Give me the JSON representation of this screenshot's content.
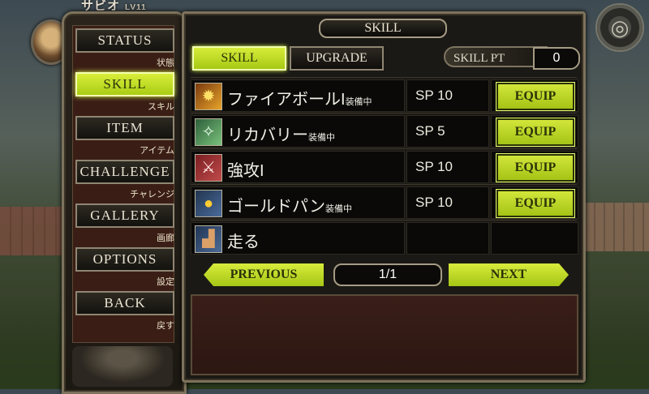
{
  "hud": {
    "player_name": "サビオ",
    "level": "LV11"
  },
  "menu": {
    "items": [
      {
        "label": "STATUS",
        "sub": "状態"
      },
      {
        "label": "SKILL",
        "sub": "スキル"
      },
      {
        "label": "ITEM",
        "sub": "アイテム"
      },
      {
        "label": "CHALLENGE",
        "sub": "チャレンジ"
      },
      {
        "label": "GALLERY",
        "sub": "画廊"
      },
      {
        "label": "OPTIONS",
        "sub": "設定"
      },
      {
        "label": "BACK",
        "sub": "戻す"
      }
    ],
    "active": "SKILL"
  },
  "panel": {
    "title": "SKILL",
    "tabs": [
      "SKILL",
      "UPGRADE"
    ],
    "skill_pt_label": "SKILL PT",
    "skill_pt_value": "0"
  },
  "skills": [
    {
      "icon": "fireball-icon",
      "name": "ファイアボールI",
      "equipped": "装備中",
      "sp": "SP 10",
      "action": "EQUIP"
    },
    {
      "icon": "recovery-icon",
      "name": "リカバリー",
      "equipped": "装備中",
      "sp": "SP 5",
      "action": "EQUIP"
    },
    {
      "icon": "power-strike-icon",
      "name": "強攻I",
      "equipped": "",
      "sp": "SP 10",
      "action": "EQUIP"
    },
    {
      "icon": "gold-pan-icon",
      "name": "ゴールドパン",
      "equipped": "装備中",
      "sp": "SP 10",
      "action": "EQUIP"
    },
    {
      "icon": "run-boot-icon",
      "name": "走る",
      "equipped": "",
      "sp": "",
      "action": ""
    }
  ],
  "pager": {
    "previous": "PREVIOUS",
    "page": "1/1",
    "next": "NEXT"
  }
}
